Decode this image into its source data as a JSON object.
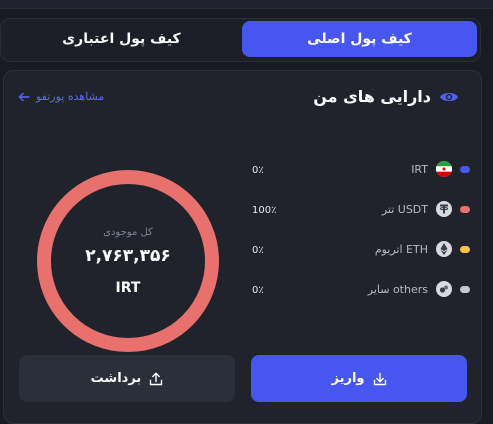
{
  "tabs": {
    "main_wallet": "کیف پول اصلی",
    "credit_wallet": "کیف پول اعتباری"
  },
  "card": {
    "title": "دارایی های من",
    "portfolio_link": "مشاهده پورتفو"
  },
  "total": {
    "label": "کل موجودی",
    "value": "۲,۷۶۳,۳۵۶",
    "unit": "IRT"
  },
  "assets": [
    {
      "name": "IRT",
      "percent": "0٪",
      "dot_color": "#4756ee",
      "icon": "iran-flag-icon"
    },
    {
      "name": "تتر USDT",
      "percent": "100٪",
      "dot_color": "#e8716d",
      "icon": "tether-icon"
    },
    {
      "name": "اتریوم ETH",
      "percent": "0٪",
      "dot_color": "#f3c34a",
      "icon": "ethereum-icon"
    },
    {
      "name": "سایر others",
      "percent": "0٪",
      "dot_color": "#c6c9d0",
      "icon": "others-icon"
    }
  ],
  "buttons": {
    "deposit": "واریز",
    "withdraw": "برداشت"
  },
  "chart_data": {
    "type": "pie",
    "categories": [
      "IRT",
      "USDT",
      "ETH",
      "others"
    ],
    "values": [
      0,
      100,
      0,
      0
    ],
    "colors": [
      "#4756ee",
      "#e8716d",
      "#f3c34a",
      "#c6c9d0"
    ]
  }
}
